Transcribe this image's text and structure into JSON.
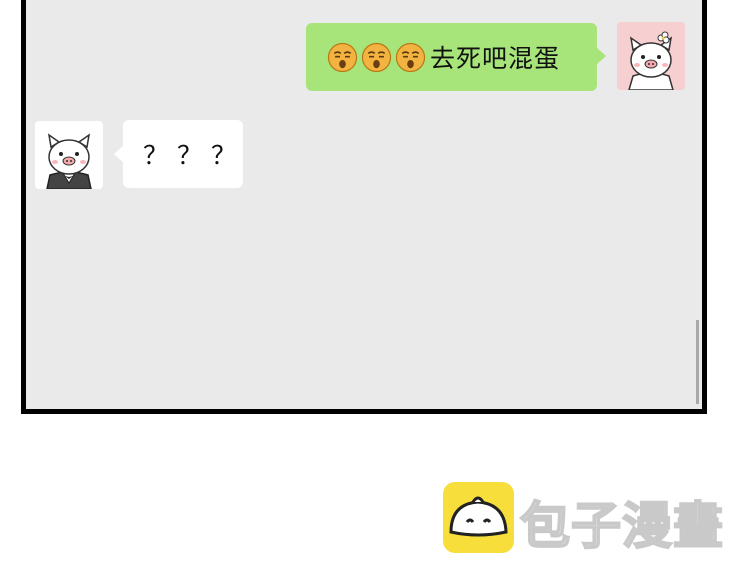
{
  "chat": {
    "outgoing": {
      "emojis": [
        "sleepy-face-emoji",
        "sleepy-face-emoji",
        "sleepy-face-emoji"
      ],
      "text": "去死吧混蛋"
    },
    "incoming": {
      "text": "？？？"
    }
  },
  "avatars": {
    "self": "pig-with-flower-avatar",
    "other": "pig-in-suit-avatar"
  },
  "watermark": {
    "text": "包子漫畫",
    "icon": "steamed-bun-logo-icon"
  },
  "colors": {
    "outgoing_bubble": "#a7e57a",
    "incoming_bubble": "#ffffff",
    "chat_background": "#eaeaea",
    "logo_yellow": "#f8de3b"
  }
}
